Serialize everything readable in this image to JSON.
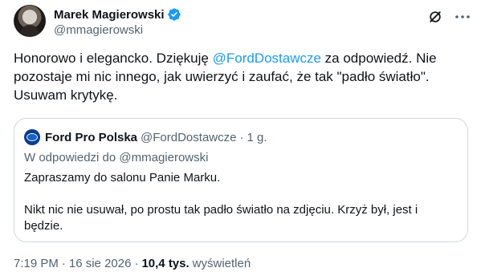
{
  "author": {
    "display_name": "Marek Magierowski",
    "handle": "@mmagierowski"
  },
  "tweet": {
    "text_before": "Honorowo i elegancko. Dziękuję ",
    "mention": "@FordDostawcze",
    "text_after": " za odpowiedź. Nie pozostaje mi nic innego, jak uwierzyć i zaufać, że tak \"padło światło\". Usuwam krytykę."
  },
  "quoted": {
    "display_name": "Ford Pro Polska",
    "handle": "@FordDostawcze",
    "dot": "·",
    "time": "1 g.",
    "reply_context": "W odpowiedzi do @mmagierowski",
    "paragraph_1": "Zapraszamy do salonu Panie Marku.",
    "paragraph_2": "Nikt nic nie usuwał, po prostu tak padło światło na zdjęciu. Krzyż był, jest i będzie."
  },
  "meta": {
    "time": "7:19 PM",
    "sep": "·",
    "date": "16 sie 2026",
    "views_count": "10,4 tys.",
    "views_label": "wyświetleń"
  },
  "icons": {
    "verified": "verified-badge-icon",
    "grok": "grok-icon",
    "more": "more-icon"
  },
  "colors": {
    "accent": "#1d9bf0",
    "text": "#0f1419",
    "secondary": "#536471",
    "border": "#cfd9de",
    "ford_blue": "#0a3d91"
  }
}
